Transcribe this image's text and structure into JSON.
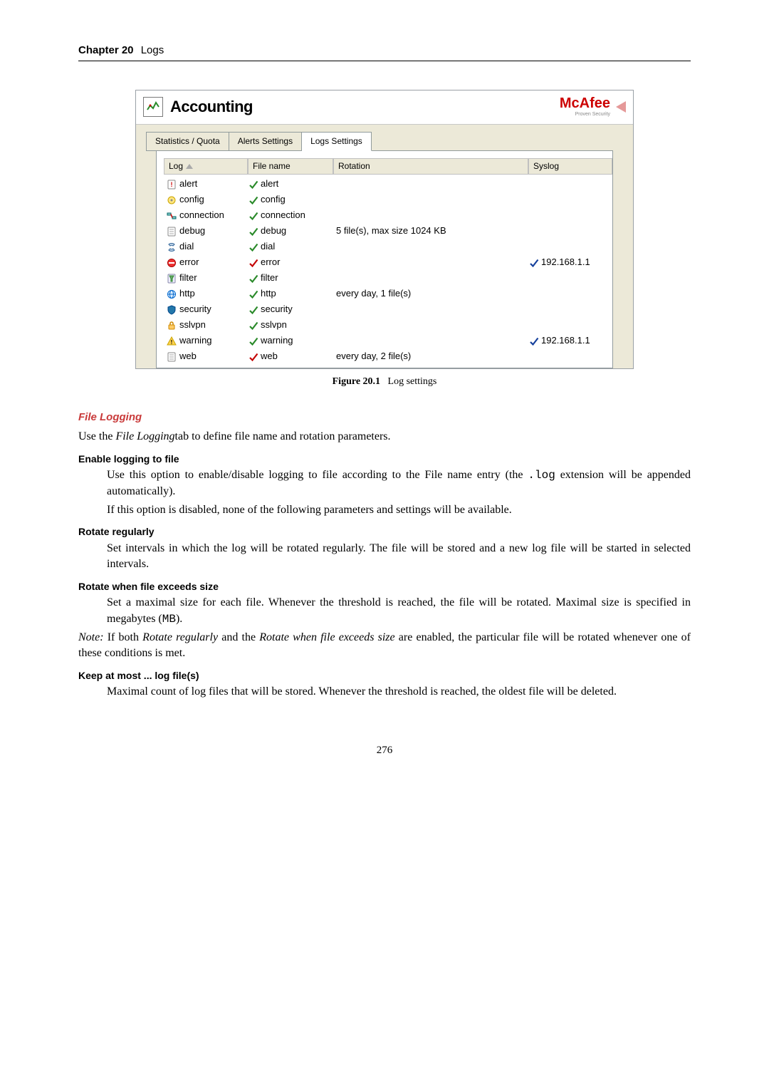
{
  "header": {
    "chapter": "Chapter 20",
    "title": "Logs"
  },
  "screenshot": {
    "window_title": "Accounting",
    "brand": {
      "name": "McAfee",
      "tagline": "Proven Security"
    },
    "tabs": [
      {
        "label": "Statistics / Quota",
        "active": false
      },
      {
        "label": "Alerts Settings",
        "active": false
      },
      {
        "label": "Logs Settings",
        "active": true
      }
    ],
    "columns": {
      "log": "Log",
      "file": "File name",
      "rotation": "Rotation",
      "syslog": "Syslog"
    },
    "rows": [
      {
        "log": "alert",
        "logicon": "alert",
        "file_ok": "green",
        "file": "alert",
        "rotation": "",
        "syslog_ok": "",
        "syslog": ""
      },
      {
        "log": "config",
        "logicon": "config",
        "file_ok": "green",
        "file": "config",
        "rotation": "",
        "syslog_ok": "",
        "syslog": ""
      },
      {
        "log": "connection",
        "logicon": "connection",
        "file_ok": "green",
        "file": "connection",
        "rotation": "",
        "syslog_ok": "",
        "syslog": ""
      },
      {
        "log": "debug",
        "logicon": "debug",
        "file_ok": "green",
        "file": "debug",
        "rotation": "5 file(s), max size 1024 KB",
        "syslog_ok": "",
        "syslog": ""
      },
      {
        "log": "dial",
        "logicon": "dial",
        "file_ok": "green",
        "file": "dial",
        "rotation": "",
        "syslog_ok": "",
        "syslog": ""
      },
      {
        "log": "error",
        "logicon": "error",
        "file_ok": "red",
        "file": "error",
        "rotation": "",
        "syslog_ok": "blue",
        "syslog": "192.168.1.1"
      },
      {
        "log": "filter",
        "logicon": "filter",
        "file_ok": "green",
        "file": "filter",
        "rotation": "",
        "syslog_ok": "",
        "syslog": ""
      },
      {
        "log": "http",
        "logicon": "http",
        "file_ok": "green",
        "file": "http",
        "rotation": "every day, 1 file(s)",
        "syslog_ok": "",
        "syslog": ""
      },
      {
        "log": "security",
        "logicon": "security",
        "file_ok": "green",
        "file": "security",
        "rotation": "",
        "syslog_ok": "",
        "syslog": ""
      },
      {
        "log": "sslvpn",
        "logicon": "sslvpn",
        "file_ok": "green",
        "file": "sslvpn",
        "rotation": "",
        "syslog_ok": "",
        "syslog": ""
      },
      {
        "log": "warning",
        "logicon": "warning",
        "file_ok": "green",
        "file": "warning",
        "rotation": "",
        "syslog_ok": "blue",
        "syslog": "192.168.1.1"
      },
      {
        "log": "web",
        "logicon": "web",
        "file_ok": "red",
        "file": "web",
        "rotation": "every day, 2 file(s)",
        "syslog_ok": "",
        "syslog": ""
      }
    ]
  },
  "figure": {
    "label": "Figure 20.1",
    "caption": "Log settings"
  },
  "body": {
    "section_title": "File Logging",
    "intro_pre": "Use the ",
    "intro_ital": "File Logging",
    "intro_post": "tab to define file name and rotation parameters.",
    "items": {
      "enable_title": "Enable logging to file",
      "enable_p1a": "Use this option to enable/disable logging to file according to the ",
      "enable_p1b": "File name",
      "enable_p1c": " entry (the ",
      "enable_ext": ".log",
      "enable_p1d": " extension will be appended automatically).",
      "enable_p2": "If this option is disabled, none of the following parameters and settings will be available.",
      "rotreg_title": "Rotate regularly",
      "rotreg_p": "Set intervals in which the log will be rotated regularly. The file will be stored and a new log file will be started in selected intervals.",
      "rotsize_title": "Rotate when file exceeds size",
      "rotsize_p_a": "Set a maximal size for each file. Whenever the threshold is reached, the file will be rotated. Maximal size is specified in megabytes (",
      "rotsize_mb": "MB",
      "rotsize_p_b": ").",
      "note_a": "Note:",
      "note_b": " If both ",
      "note_c": "Rotate regularly",
      "note_d": " and the ",
      "note_e": "Rotate when file exceeds size",
      "note_f": " are enabled, the particular file will be rotated whenever one of these conditions is met.",
      "keep_title": "Keep at most ... log file(s)",
      "keep_p": "Maximal count of log files that will be stored. Whenever the threshold is reached, the oldest file will be deleted."
    }
  },
  "page_number": "276"
}
